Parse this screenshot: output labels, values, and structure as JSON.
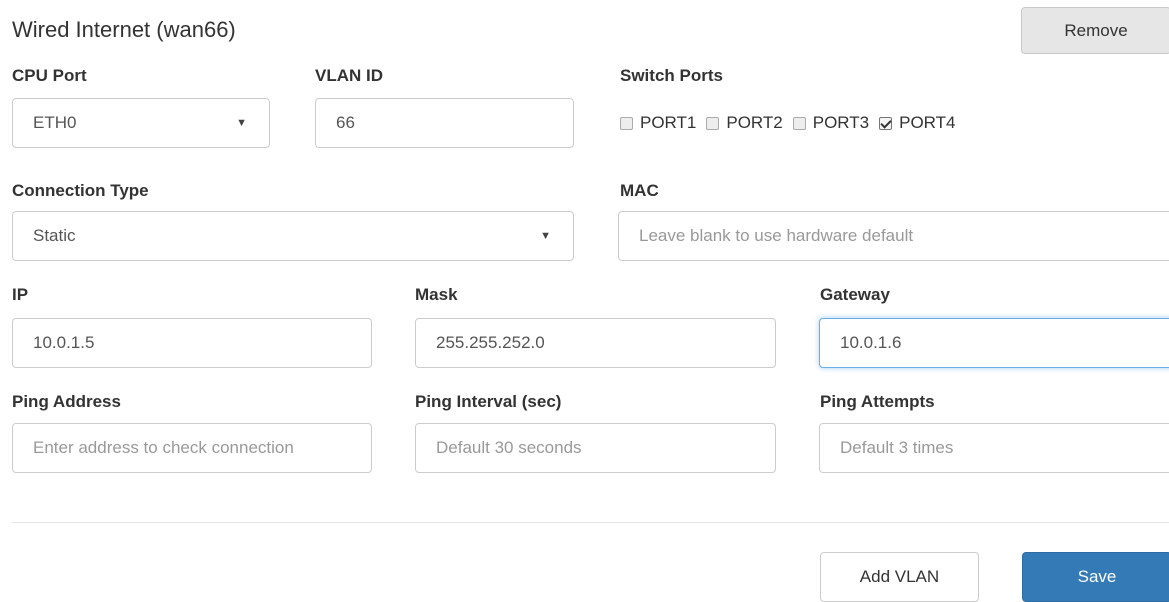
{
  "section_title": "Wired Internet (wan66)",
  "remove_label": "Remove",
  "cpu_port": {
    "label": "CPU Port",
    "value": "ETH0"
  },
  "vlan_id": {
    "label": "VLAN ID",
    "value": "66"
  },
  "switch_ports": {
    "label": "Switch Ports",
    "ports": [
      {
        "name": "PORT1",
        "checked": false
      },
      {
        "name": "PORT2",
        "checked": false
      },
      {
        "name": "PORT3",
        "checked": false
      },
      {
        "name": "PORT4",
        "checked": true
      }
    ]
  },
  "connection_type": {
    "label": "Connection Type",
    "value": "Static"
  },
  "mac": {
    "label": "MAC",
    "value": "",
    "placeholder": "Leave blank to use hardware default"
  },
  "ip": {
    "label": "IP",
    "value": "10.0.1.5"
  },
  "mask": {
    "label": "Mask",
    "value": "255.255.252.0"
  },
  "gateway": {
    "label": "Gateway",
    "value": "10.0.1.6"
  },
  "ping_address": {
    "label": "Ping Address",
    "value": "",
    "placeholder": "Enter address to check connection"
  },
  "ping_interval": {
    "label": "Ping Interval (sec)",
    "value": "",
    "placeholder": "Default 30 seconds"
  },
  "ping_attempts": {
    "label": "Ping Attempts",
    "value": "",
    "placeholder": "Default 3 times"
  },
  "footer": {
    "add_vlan_label": "Add VLAN",
    "save_label": "Save"
  },
  "colors": {
    "primary": "#337ab7",
    "focus_border": "#66afe9",
    "remove_bg": "#e6e6e6"
  }
}
